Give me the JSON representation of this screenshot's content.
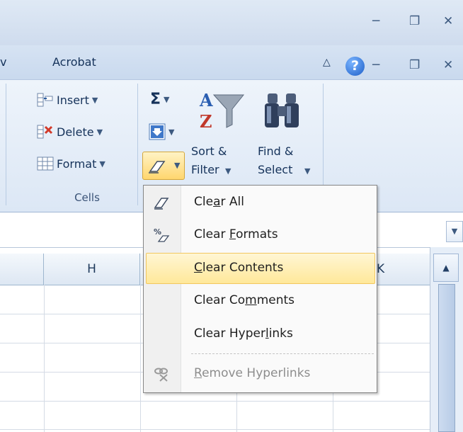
{
  "window": {
    "minimize_glyph": "─",
    "restore_glyph": "❐",
    "close_glyph": "✕"
  },
  "tabs": {
    "partial_left": "v",
    "acrobat": "Acrobat",
    "caret_up": "△",
    "help": "?"
  },
  "ribbon": {
    "cells_group": {
      "insert": "Insert",
      "delete": "Delete",
      "format": "Format",
      "name": "Cells"
    },
    "editing_group": {
      "sigma": "Σ",
      "sort_filter_line1": "Sort &",
      "sort_filter_line2": "Filter",
      "find_select_line1": "Find &",
      "find_select_line2": "Select"
    }
  },
  "grid": {
    "columns": [
      "H",
      "K"
    ]
  },
  "menu": {
    "items": [
      {
        "label_pre": "Cle",
        "label_u": "a",
        "label_post": "r All",
        "icon": "eraser-icon",
        "enabled": true,
        "highlighted": false
      },
      {
        "label_pre": "Clear ",
        "label_u": "F",
        "label_post": "ormats",
        "icon": "clear-formats-icon",
        "enabled": true,
        "highlighted": false
      },
      {
        "label_pre": "",
        "label_u": "C",
        "label_post": "lear Contents",
        "icon": "",
        "enabled": true,
        "highlighted": true
      },
      {
        "label_pre": "Clear Co",
        "label_u": "m",
        "label_post": "ments",
        "icon": "",
        "enabled": true,
        "highlighted": false
      },
      {
        "label_pre": "Clear Hyper",
        "label_u": "l",
        "label_post": "inks",
        "icon": "",
        "enabled": true,
        "highlighted": false
      },
      {
        "label_pre": "",
        "label_u": "R",
        "label_post": "emove Hyperlinks",
        "icon": "remove-link-icon",
        "enabled": false,
        "highlighted": false
      }
    ]
  },
  "colors": {
    "ribbon_bg": "#dce7f5",
    "menu_highlight": "#ffe89a",
    "help_blue": "#1d5fc8"
  }
}
